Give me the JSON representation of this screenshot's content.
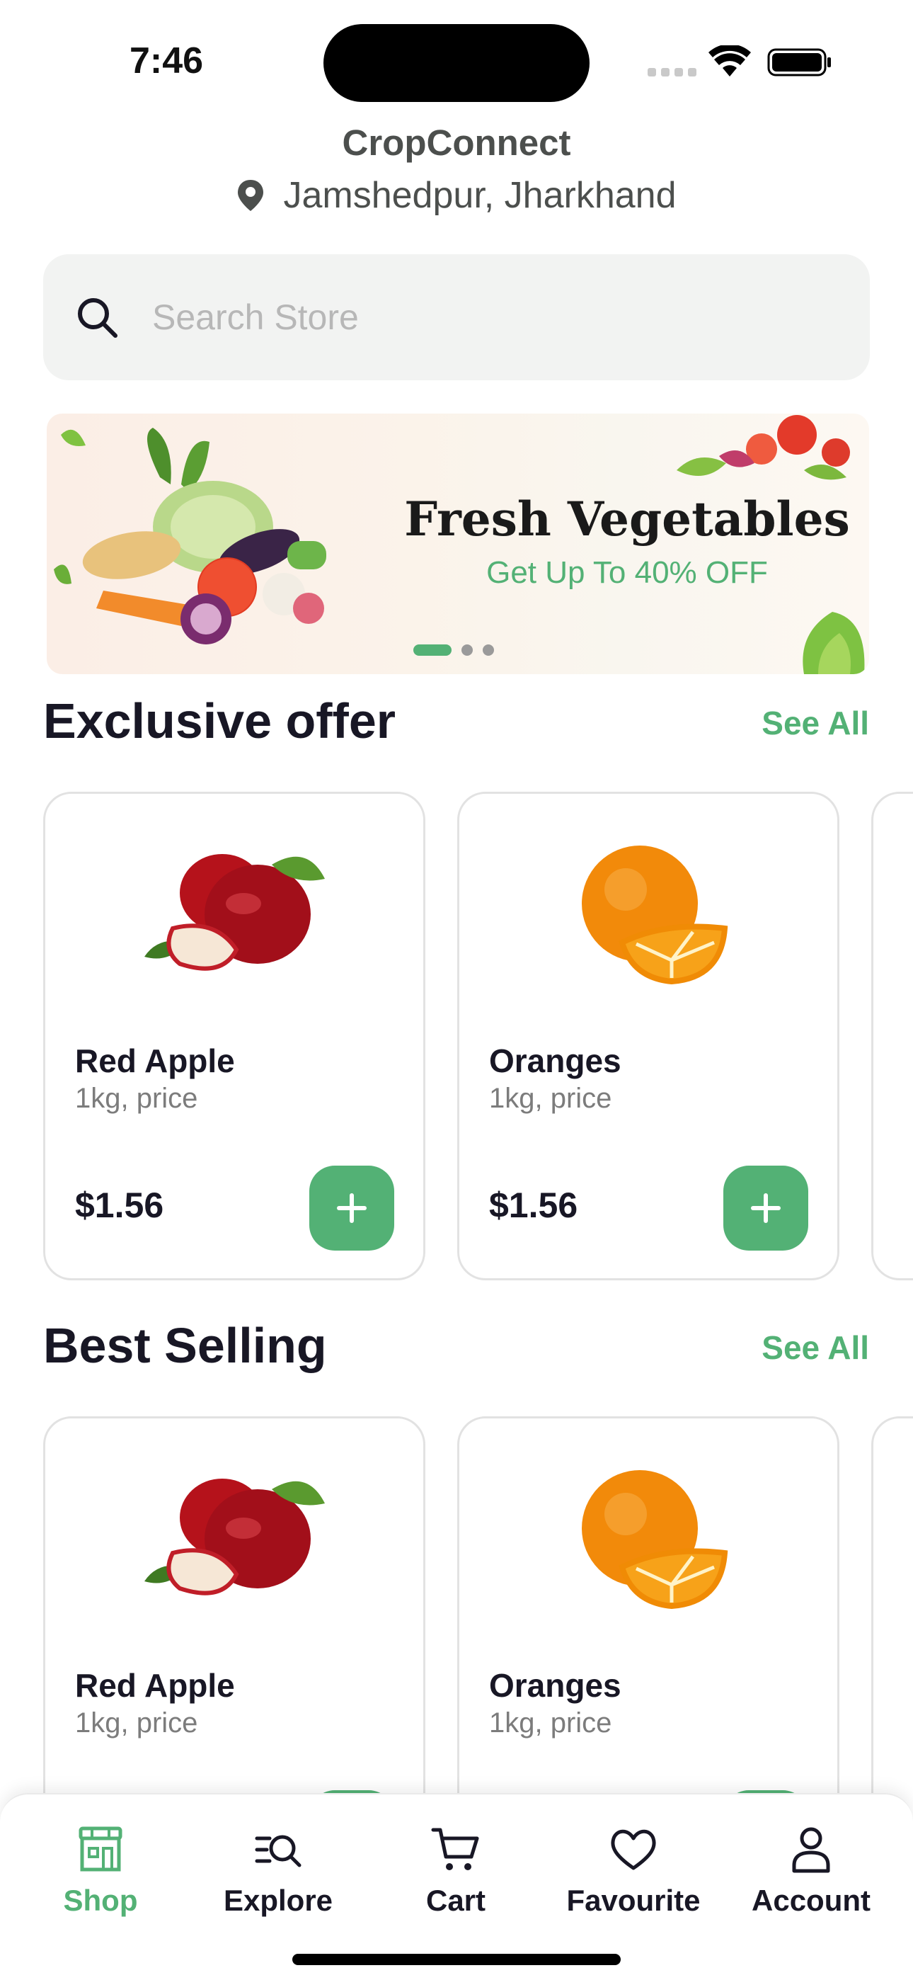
{
  "status": {
    "time": "7:46"
  },
  "header": {
    "title": "CropConnect",
    "location": "Jamshedpur, Jharkhand"
  },
  "search": {
    "placeholder": "Search Store"
  },
  "banner": {
    "title": "Fresh Vegetables",
    "subtitle": "Get Up To 40% OFF",
    "pages": 3,
    "active_page": 1
  },
  "sections": {
    "exclusive": {
      "title": "Exclusive offer",
      "see_all": "See All",
      "products": [
        {
          "name": "Red Apple",
          "unit": "1kg, price",
          "price": "$1.56",
          "image": "red-apple"
        },
        {
          "name": "Oranges",
          "unit": "1kg, price",
          "price": "$1.56",
          "image": "orange"
        }
      ]
    },
    "best_selling": {
      "title": "Best Selling",
      "see_all": "See All",
      "products": [
        {
          "name": "Red Apple",
          "unit": "1kg, price",
          "image": "red-apple"
        },
        {
          "name": "Oranges",
          "unit": "1kg, price",
          "image": "orange"
        }
      ]
    }
  },
  "tabs": [
    {
      "label": "Shop",
      "icon": "store-icon",
      "active": true
    },
    {
      "label": "Explore",
      "icon": "explore-icon",
      "active": false
    },
    {
      "label": "Cart",
      "icon": "cart-icon",
      "active": false
    },
    {
      "label": "Favourite",
      "icon": "heart-icon",
      "active": false
    },
    {
      "label": "Account",
      "icon": "user-icon",
      "active": false
    }
  ],
  "colors": {
    "accent": "#53B175",
    "text": "#181725",
    "muted": "#7C7C7C",
    "search_bg": "#F2F3F2"
  }
}
